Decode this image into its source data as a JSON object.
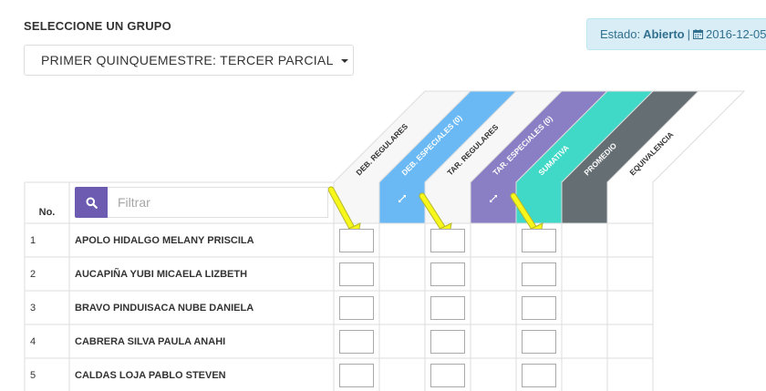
{
  "header": {
    "title": "SELECCIONE UN GRUPO",
    "period_selected": "PRIMER QUINQUEMESTRE: TERCER PARCIAL"
  },
  "status": {
    "label": "Estado:",
    "value": "Abierto",
    "separator": "|",
    "date": "2016-12-05"
  },
  "table": {
    "number_header": "No.",
    "filter_placeholder": "Filtrar",
    "columns": [
      {
        "label": "DEB. REGULARES",
        "color": "#f7f7f7",
        "text_color": "#333333",
        "expand_icon": false
      },
      {
        "label": "DEB. ESPECIALES (0)",
        "color": "#6ab9f5",
        "text_color": "#ffffff",
        "expand_icon": true
      },
      {
        "label": "TAR. REGULARES",
        "color": "#f7f7f7",
        "text_color": "#333333",
        "expand_icon": false
      },
      {
        "label": "TAR. ESPECIALES (0)",
        "color": "#8a7fc4",
        "text_color": "#ffffff",
        "expand_icon": true
      },
      {
        "label": "SUMATIVA",
        "color": "#40d8c7",
        "text_color": "#ffffff",
        "expand_icon": false
      },
      {
        "label": "PROMEDIO",
        "color": "#646e73",
        "text_color": "#ffffff",
        "expand_icon": false
      },
      {
        "label": "EQUIVALENCIA",
        "color": "#ffffff",
        "text_color": "#333333",
        "expand_icon": false
      }
    ],
    "rows": [
      {
        "no": "1",
        "name": "APOLO HIDALGO MELANY PRISCILA"
      },
      {
        "no": "2",
        "name": "AUCAPIÑA YUBI MICAELA LIZBETH"
      },
      {
        "no": "3",
        "name": "BRAVO PINDUISACA NUBE DANIELA"
      },
      {
        "no": "4",
        "name": "CABRERA SILVA PAULA ANAHI"
      },
      {
        "no": "5",
        "name": "CALDAS LOJA PABLO STEVEN"
      }
    ]
  },
  "annotations": {
    "arrow_color": "#f7f71c",
    "arrow_count": 3
  }
}
